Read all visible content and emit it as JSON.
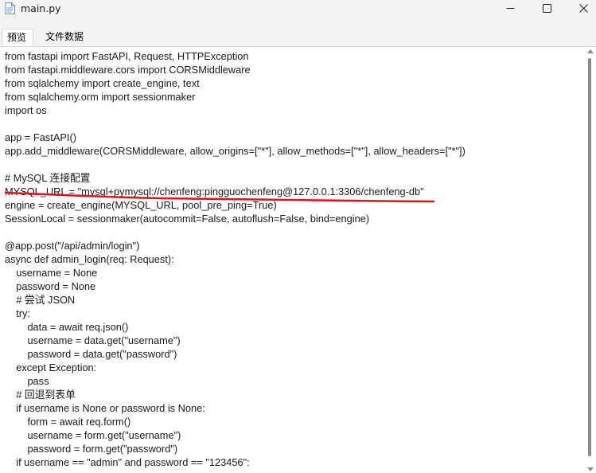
{
  "window": {
    "title": "main.py",
    "file_icon": "document-icon",
    "controls": {
      "minimize_icon": "minimize-icon",
      "maximize_icon": "maximize-icon",
      "close_icon": "close-icon"
    }
  },
  "tabs": [
    {
      "label": "预览",
      "active": true
    },
    {
      "label": "文件数据",
      "active": false
    }
  ],
  "code_lines": [
    "from fastapi import FastAPI, Request, HTTPException",
    "from fastapi.middleware.cors import CORSMiddleware",
    "from sqlalchemy import create_engine, text",
    "from sqlalchemy.orm import sessionmaker",
    "import os",
    "",
    "app = FastAPI()",
    "app.add_middleware(CORSMiddleware, allow_origins=[\"*\"], allow_methods=[\"*\"], allow_headers=[\"*\"])",
    "",
    "# MySQL 连接配置",
    "MYSQL_URL = \"mysql+pymysql://chenfeng:pingguochenfeng@127.0.0.1:3306/chenfeng-db\"",
    "engine = create_engine(MYSQL_URL, pool_pre_ping=True)",
    "SessionLocal = sessionmaker(autocommit=False, autoflush=False, bind=engine)",
    "",
    "@app.post(\"/api/admin/login\")",
    "async def admin_login(req: Request):",
    "    username = None",
    "    password = None",
    "    # 尝试 JSON",
    "    try:",
    "        data = await req.json()",
    "        username = data.get(\"username\")",
    "        password = data.get(\"password\")",
    "    except Exception:",
    "        pass",
    "    # 回退到表单",
    "    if username is None or password is None:",
    "        form = await req.form()",
    "        username = form.get(\"username\")",
    "        password = form.get(\"password\")",
    "    if username == \"admin\" and password == \"123456\":"
  ],
  "annotation": {
    "color": "#e0111b",
    "marks_line": 10
  }
}
